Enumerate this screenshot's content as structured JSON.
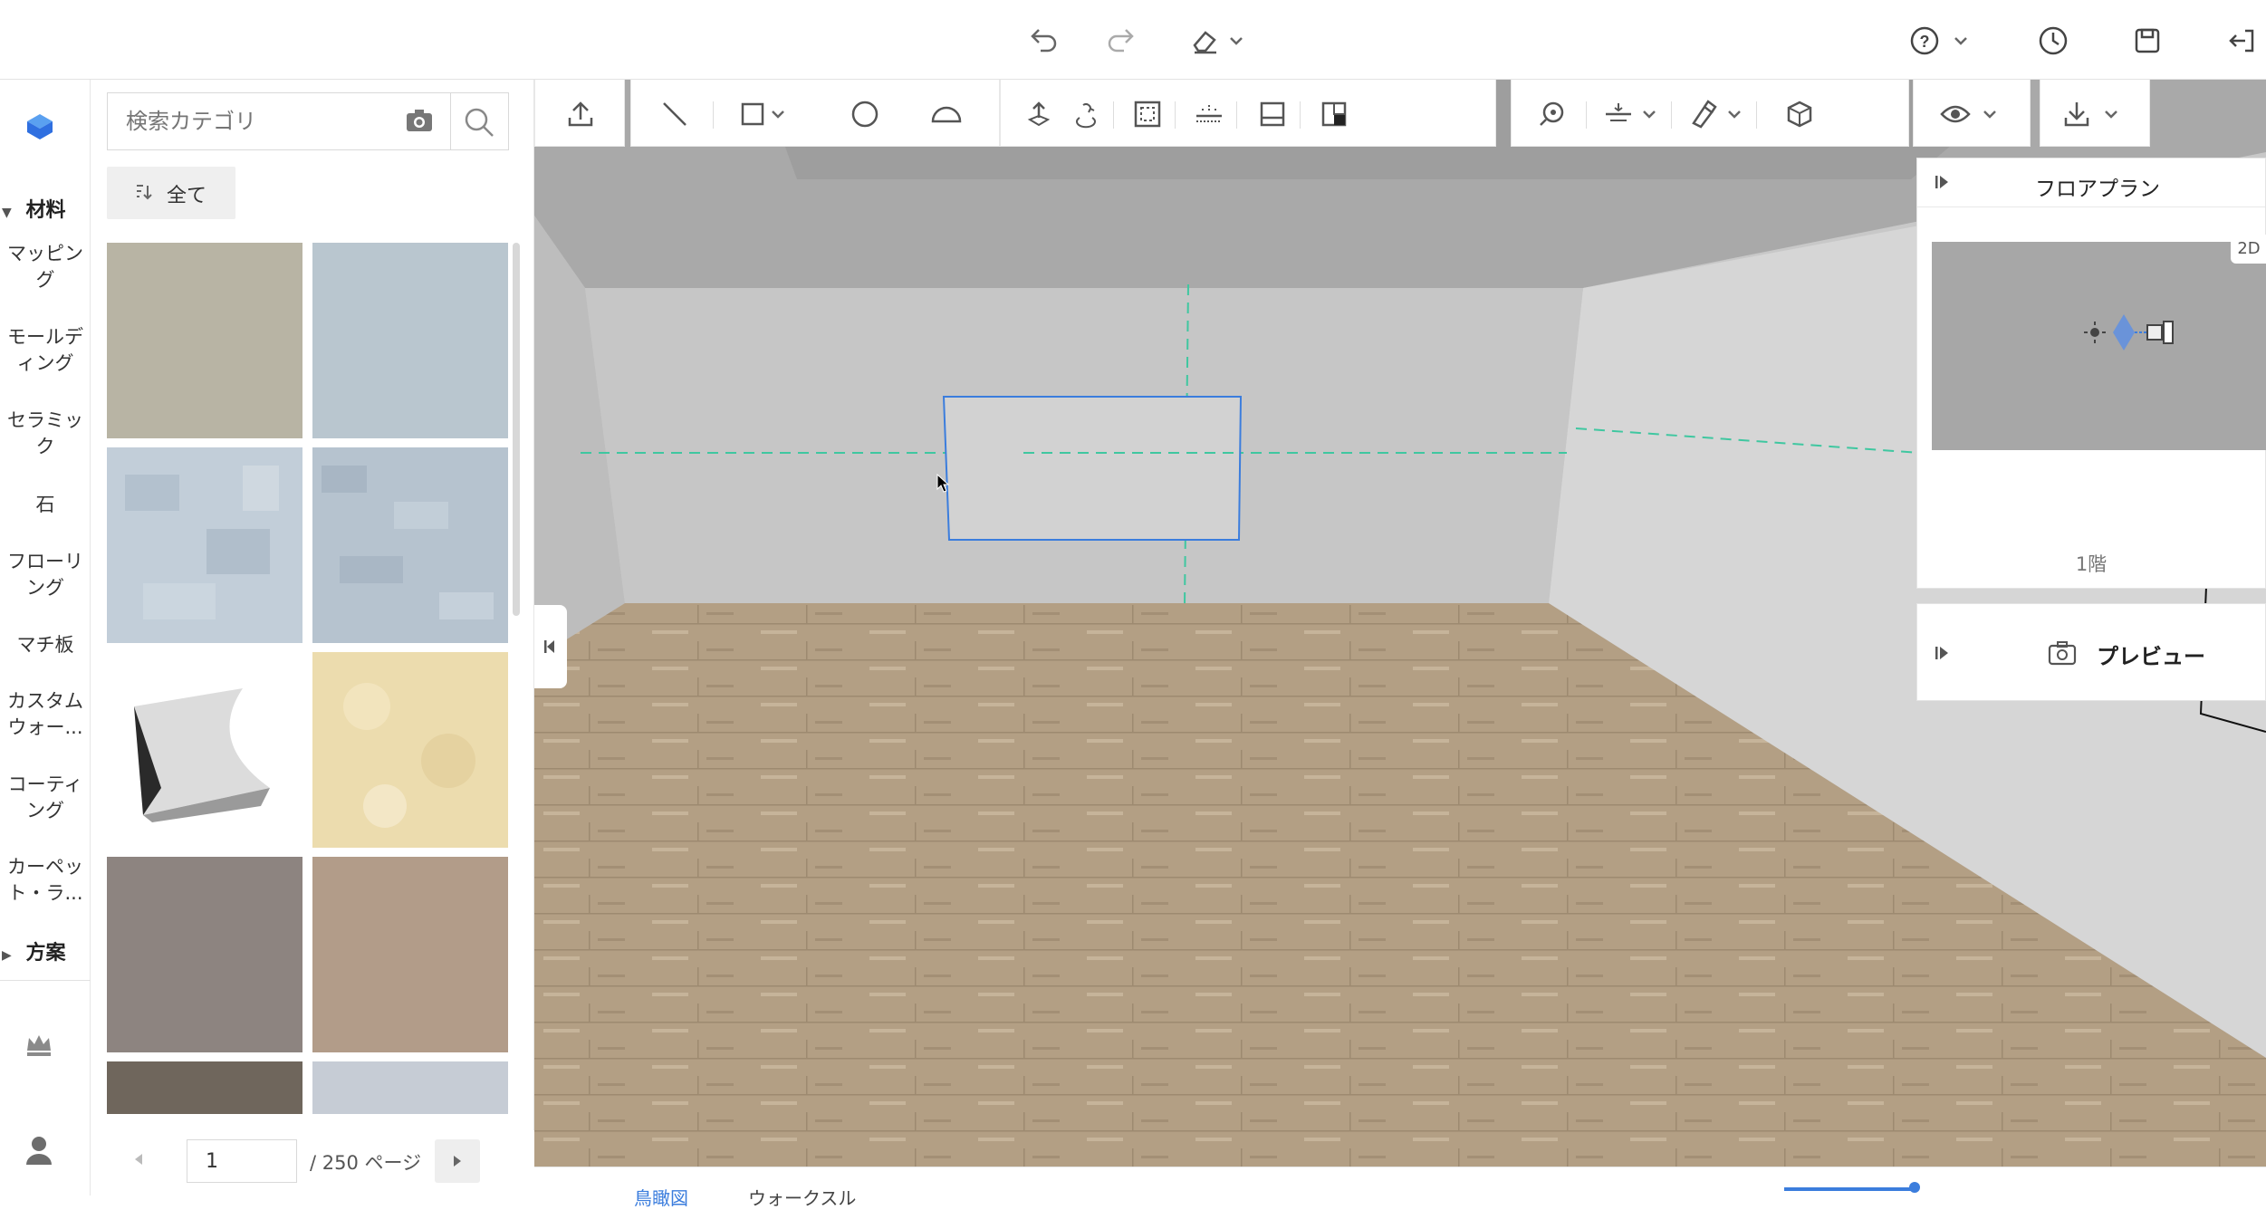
{
  "topbar": {
    "undo_icon": "undo-icon",
    "redo_icon": "redo-icon",
    "eraser_icon": "eraser-icon",
    "help_icon": "help-icon",
    "history_icon": "clock-icon",
    "save_icon": "save-icon",
    "exit_icon": "exit-icon"
  },
  "sidebar": {
    "materials_header": "材料",
    "items": [
      {
        "label": "マッピング"
      },
      {
        "label": "モールディング"
      },
      {
        "label": "セラミック"
      },
      {
        "label": "石"
      },
      {
        "label": "フローリング"
      },
      {
        "label": "マチ板"
      },
      {
        "label": "カスタムウォー..."
      },
      {
        "label": "コーティング"
      },
      {
        "label": "カーペット・ラ..."
      }
    ],
    "plans_header": "方案"
  },
  "library": {
    "search_placeholder": "検索カテゴリ",
    "filter_label": "全て",
    "tiles": [
      {
        "name": "beige-plain",
        "color": "#b8b4a4"
      },
      {
        "name": "blue-grey-plain",
        "color": "#b9c6cf"
      },
      {
        "name": "blue-mottled",
        "color": "#c2ced9"
      },
      {
        "name": "blue-textured",
        "color": "#b6c3cf"
      },
      {
        "name": "cove-molding",
        "color": "#eeeeee"
      },
      {
        "name": "cream-pattern",
        "color": "#ecdcae"
      },
      {
        "name": "grey-brown-plain",
        "color": "#8d8480"
      },
      {
        "name": "tan-plain",
        "color": "#b29c89"
      },
      {
        "name": "rust-textured",
        "color": "#6f665c"
      },
      {
        "name": "pale-blue",
        "color": "#c6ccd5"
      }
    ],
    "page_current": "1",
    "page_total": "/ 250 ページ"
  },
  "right_panel": {
    "floorplan_title": "フロアプラン",
    "floorplan_mode": "2D",
    "floor_label": "1階",
    "preview_title": "プレビュー"
  },
  "bottom": {
    "view_tab_1": "鳥瞰図",
    "view_tab_2": "ウォークスル"
  },
  "colors": {
    "accent": "#3b7ddd",
    "guide": "#3fc7a0",
    "floor": "#b39f84",
    "wall": "#c8c8c8"
  }
}
